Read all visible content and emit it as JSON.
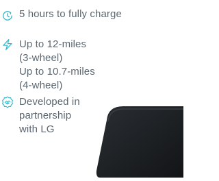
{
  "features": [
    {
      "icon": "clock-icon",
      "lines": [
        "5 hours to fully charge"
      ]
    },
    {
      "icon": "lightning-bolt-icon",
      "lines": [
        "Up to 12-miles",
        "(3-wheel)",
        "Up to 10.7-miles",
        "(4-wheel)"
      ]
    },
    {
      "icon": "partnership-badge-icon",
      "lines": [
        "Developed in",
        "partnership",
        "with LG"
      ]
    }
  ],
  "colors": {
    "text": "#5c6770",
    "icon": "#2bb7c9",
    "device": "#1c1f22"
  }
}
